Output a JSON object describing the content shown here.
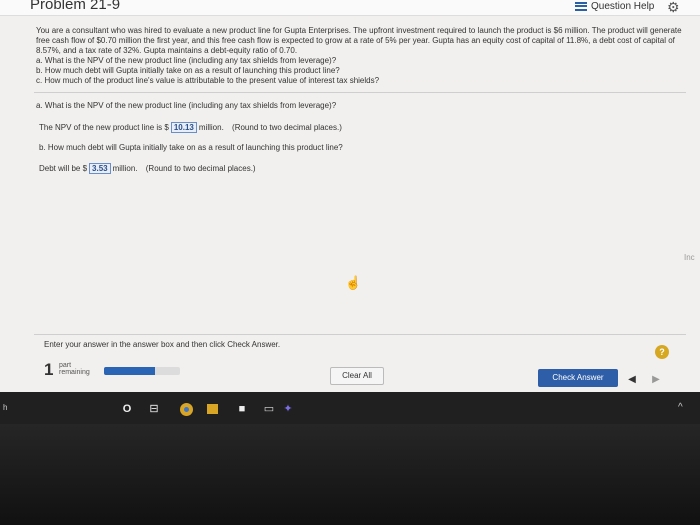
{
  "header": {
    "title": "Problem 21-9",
    "help_label": "Question Help"
  },
  "problem": {
    "intro": "You are a consultant who was hired to evaluate a new product line for Gupta Enterprises. The upfront investment required to launch the product is $6 million. The product will generate free cash flow of $0.70 million the first year, and this free cash flow is expected to grow at a rate of 5% per year. Gupta has an equity cost of capital of 11.8%, a debt cost of capital of 8.57%, and a tax rate of 32%. Gupta maintains a debt-equity ratio of 0.70.",
    "q_a": "a. What is the NPV of the new product line (including any tax shields from leverage)?",
    "q_b": "b. How much debt will Gupta initially take on as a result of launching this product line?",
    "q_c": "c. How much of the product line's value is attributable to the present value of interest tax shields?"
  },
  "part_a": {
    "question": "a. What is the NPV of the new product line (including any tax shields from leverage)?",
    "prefix": "The NPV of the new product line is $",
    "answer": "10.13",
    "suffix": "million.",
    "hint": "(Round to two decimal places.)"
  },
  "part_b": {
    "question": "b. How much debt will Gupta initially take on as a result of launching this product line?",
    "prefix": "Debt will be $",
    "answer": "3.53",
    "suffix": "million.",
    "hint": "(Round to two decimal places.)"
  },
  "side_note": "Inc",
  "footer": {
    "instruction": "Enter your answer in the answer box and then click Check Answer.",
    "help_symbol": "?",
    "parts_number": "1",
    "parts_word_1": "part",
    "parts_word_2": "remaining",
    "progress_fraction": 0.67,
    "clear_label": "Clear All",
    "check_label": "Check Answer",
    "prev_symbol": "◀",
    "next_symbol": "▶"
  },
  "taskbar": {
    "left_text": "h",
    "search_symbol": "O",
    "taskview_symbol": "⊟",
    "caret_symbol": "^",
    "icons": [
      "search-icon",
      "task-view-icon",
      "chrome-icon",
      "file-explorer-icon",
      "store-icon",
      "mail-icon",
      "app-icon"
    ]
  },
  "colors": {
    "accent": "#2e5ea8",
    "help": "#d6a821",
    "progress": "#2a64b5"
  }
}
